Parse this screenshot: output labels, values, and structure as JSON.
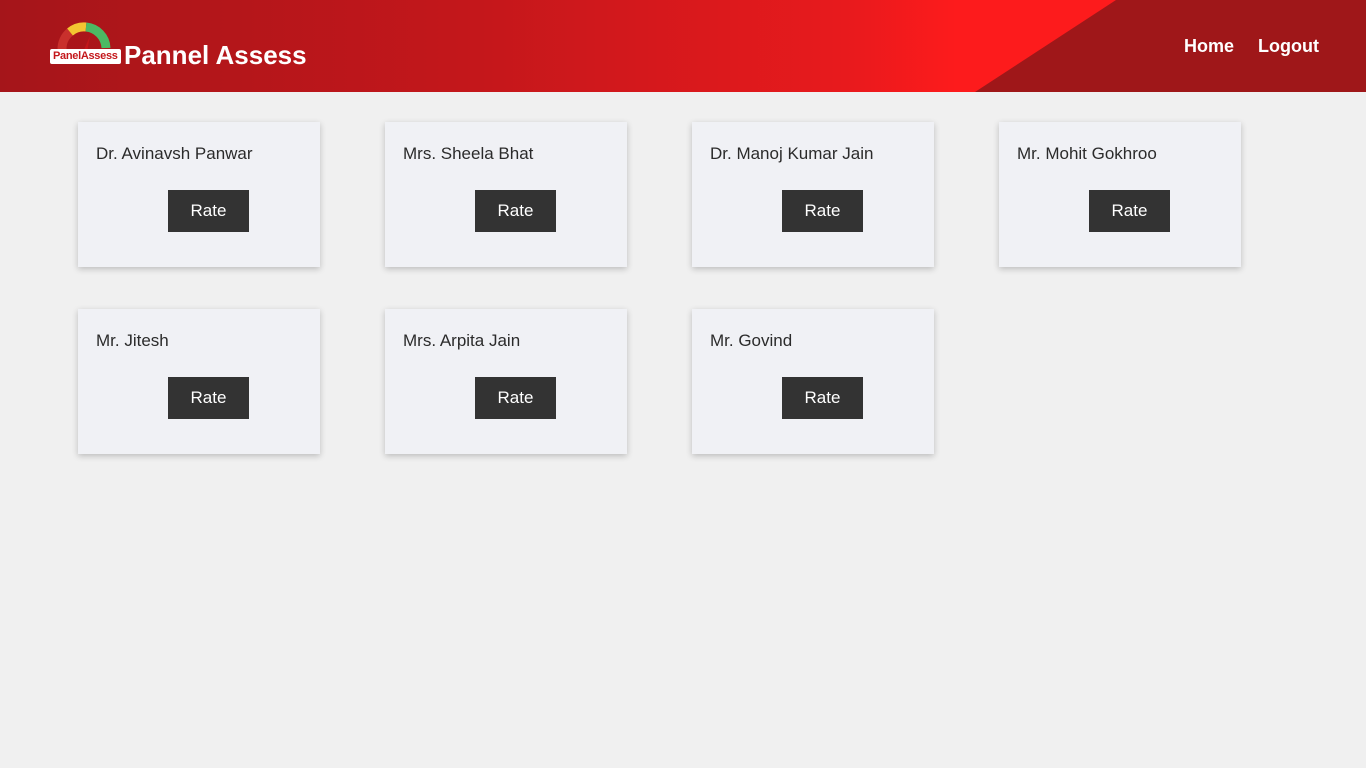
{
  "header": {
    "logo_label": "PanelAssess",
    "title": "Pannel Assess",
    "nav": {
      "home": "Home",
      "logout": "Logout"
    }
  },
  "panelists": [
    {
      "name": "Dr. Avinavsh Panwar",
      "button": "Rate"
    },
    {
      "name": "Mrs. Sheela Bhat",
      "button": "Rate"
    },
    {
      "name": "Dr. Manoj Kumar Jain",
      "button": "Rate"
    },
    {
      "name": "Mr. Mohit Gokhroo",
      "button": "Rate"
    },
    {
      "name": "Mr. Jitesh",
      "button": "Rate"
    },
    {
      "name": "Mrs. Arpita Jain",
      "button": "Rate"
    },
    {
      "name": "Mr. Govind",
      "button": "Rate"
    }
  ],
  "colors": {
    "header_red": "#c4171b",
    "page_bg": "#f0f0f0",
    "card_bg": "#f0f1f5",
    "button_bg": "#333333"
  },
  "icons": {
    "logo": "speedometer-gauge-icon"
  }
}
